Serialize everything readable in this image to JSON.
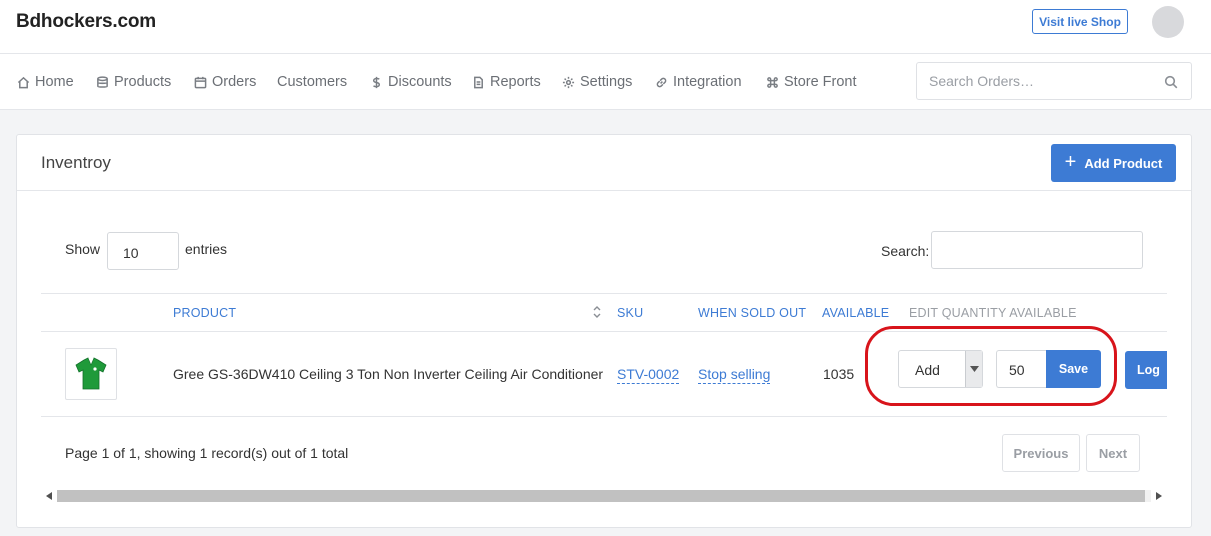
{
  "header": {
    "brand": "Bdhockers.com",
    "live_shop_label": "Visit live Shop"
  },
  "nav": {
    "items": [
      {
        "label": "Home",
        "icon": "home-icon"
      },
      {
        "label": "Products",
        "icon": "database-icon"
      },
      {
        "label": "Orders",
        "icon": "calendar-icon"
      },
      {
        "label": "Customers",
        "icon": ""
      },
      {
        "label": "Discounts",
        "icon": "dollar-icon"
      },
      {
        "label": "Reports",
        "icon": "document-icon"
      },
      {
        "label": "Settings",
        "icon": "gear-icon"
      },
      {
        "label": "Integration",
        "icon": "link-icon"
      },
      {
        "label": "Store Front",
        "icon": "command-icon"
      }
    ],
    "search_placeholder": "Search Orders…"
  },
  "card": {
    "title": "Inventroy",
    "add_button_label": "Add Product"
  },
  "table_controls": {
    "show_label": "Show",
    "entries_value": "10",
    "entries_label": "entries",
    "search_label": "Search:",
    "search_value": ""
  },
  "table": {
    "columns": [
      "PRODUCT",
      "SKU",
      "WHEN SOLD OUT",
      "AVAILABLE",
      "EDIT QUANTITY AVAILABLE"
    ],
    "rows": [
      {
        "product": "Gree GS-36DW410 Ceiling 3 Ton Non Inverter Ceiling Air Conditioner",
        "sku": "STV-0002",
        "when_sold_out": "Stop selling",
        "available": "1035",
        "adjust_mode": "Add",
        "quantity": "50",
        "save_label": "Save",
        "log_label": "Log"
      }
    ]
  },
  "pagination": {
    "info": "Page 1 of 1, showing 1 record(s) out of 1 total",
    "previous_label": "Previous",
    "next_label": "Next"
  },
  "colors": {
    "accent": "#3d7bd4",
    "highlight": "#d8141b"
  }
}
